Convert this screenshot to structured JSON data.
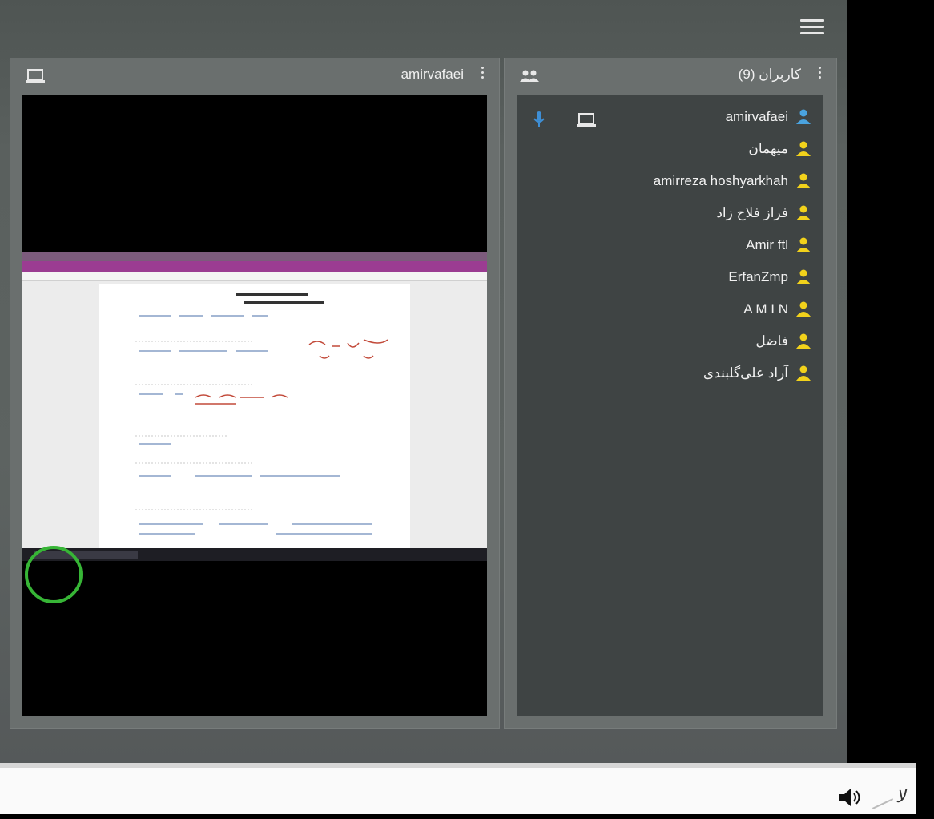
{
  "share_panel": {
    "title": "amirvafaei",
    "icon": "laptop-icon"
  },
  "users_panel": {
    "title": "کاربران (9)",
    "icon": "people-icon",
    "users": [
      {
        "name": "amirvafaei",
        "icon_color": "#4aa3df"
      },
      {
        "name": "میهمان",
        "icon_color": "#f2d21b"
      },
      {
        "name": "amirreza hoshyarkhah",
        "icon_color": "#f2d21b"
      },
      {
        "name": "فراز فلاح زاد",
        "icon_color": "#f2d21b"
      },
      {
        "name": "Amir ftl",
        "icon_color": "#f2d21b"
      },
      {
        "name": "ErfanZmp",
        "icon_color": "#f2d21b"
      },
      {
        "name": "A M I N",
        "icon_color": "#f2d21b"
      },
      {
        "name": "فاضل",
        "icon_color": "#f2d21b"
      },
      {
        "name": "آراد علی‌گلبندی",
        "icon_color": "#f2d21b"
      }
    ],
    "first_user_status": {
      "mic": "mic-icon",
      "device": "laptop-icon",
      "mic_color": "#3e8fd6"
    }
  },
  "menu": {
    "icon": "hamburger-menu-icon"
  },
  "player": {
    "speaker_icon": "speaker-icon"
  },
  "colors": {
    "accent_blue": "#4aa3df",
    "guest_yellow": "#f2d21b",
    "cursor_ring": "#37b536"
  }
}
